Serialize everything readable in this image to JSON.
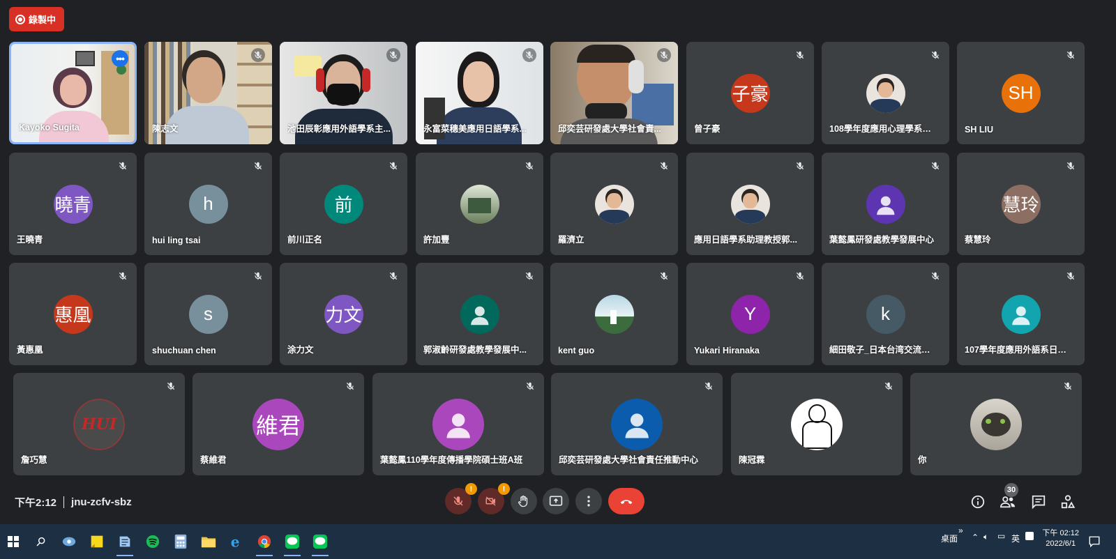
{
  "recording": {
    "label": "錄製中"
  },
  "participants": [
    {
      "name": "Kayoko Sugita",
      "type": "video",
      "active": true
    },
    {
      "name": "陳志文",
      "type": "video"
    },
    {
      "name": "池田辰彰應用外語學系主...",
      "type": "video"
    },
    {
      "name": "永富菜穗美應用日語學系...",
      "type": "video"
    },
    {
      "name": "邱奕芸研發處大學社會責...",
      "type": "video"
    },
    {
      "name": "曾子豪",
      "type": "avatar",
      "initials": "子豪",
      "color": "#c5381b"
    },
    {
      "name": "108學年度應用心理學系碩...",
      "type": "photo",
      "photo": "person-photo"
    },
    {
      "name": "SH LIU",
      "type": "avatar",
      "initials": "SH",
      "color": "#e8710a"
    },
    {
      "name": "王曉青",
      "type": "avatar",
      "initials": "曉青",
      "color": "#7e57c2"
    },
    {
      "name": "hui ling tsai",
      "type": "avatar",
      "initials": "h",
      "color": "#78909c"
    },
    {
      "name": "前川正名",
      "type": "avatar",
      "initials": "前",
      "color": "#00897b"
    },
    {
      "name": "許加豐",
      "type": "photo",
      "photo": "building-photo"
    },
    {
      "name": "羅濟立",
      "type": "photo",
      "photo": "person-photo"
    },
    {
      "name": "應用日語學系助理教授郭...",
      "type": "photo",
      "photo": "person-photo"
    },
    {
      "name": "葉懿鳳研發處教學發展中心",
      "type": "avatar",
      "initials": "",
      "color": "#5e35b1",
      "generic": true
    },
    {
      "name": "蔡慧玲",
      "type": "avatar",
      "initials": "慧玲",
      "color": "#8d6e63"
    },
    {
      "name": "黃惠凰",
      "type": "avatar",
      "initials": "惠凰",
      "color": "#c5381b"
    },
    {
      "name": "shuchuan chen",
      "type": "avatar",
      "initials": "s",
      "color": "#78909c"
    },
    {
      "name": "涂力文",
      "type": "avatar",
      "initials": "力文",
      "color": "#7e57c2"
    },
    {
      "name": "郭淑齡研發處教學發展中...",
      "type": "avatar",
      "initials": "",
      "color": "#00695c",
      "generic": true
    },
    {
      "name": "kent guo",
      "type": "photo",
      "photo": "landscape-photo"
    },
    {
      "name": "Yukari Hiranaka",
      "type": "avatar",
      "initials": "Y",
      "color": "#8e24aa"
    },
    {
      "name": "細田敬子_日本台湾交流協会",
      "type": "avatar",
      "initials": "k",
      "color": "#455a64"
    },
    {
      "name": "107學年度應用外語系日文...",
      "type": "avatar",
      "initials": "",
      "color": "#12a4af",
      "generic": true
    },
    {
      "name": "詹巧慧",
      "type": "photo",
      "photo": "logo-photo",
      "logo_text": "HUI"
    },
    {
      "name": "蔡維君",
      "type": "avatar",
      "initials": "維君",
      "color": "#ab47bc"
    },
    {
      "name": "葉懿鳳110學年度傳播學院碩士班A班",
      "type": "avatar",
      "initials": "",
      "color": "#ab47bc",
      "generic": true
    },
    {
      "name": "邱奕芸研發處大學社會責任推動中心",
      "type": "avatar",
      "initials": "",
      "color": "#0b5cad",
      "generic": true
    },
    {
      "name": "陳冠霖",
      "type": "photo",
      "photo": "sketch-photo"
    },
    {
      "name": "你",
      "type": "photo",
      "photo": "cat-photo"
    }
  ],
  "meeting": {
    "time": "下午2:12",
    "code": "jnu-zcfv-sbz"
  },
  "controls": {
    "warn_mark": "!",
    "people_count": "30",
    "more_dots": "•••"
  },
  "taskbar": {
    "desktop_label": "桌面",
    "overflow": "»",
    "ime": "英",
    "clock_time": "下午 02:12",
    "clock_date": "2022/6/1"
  }
}
